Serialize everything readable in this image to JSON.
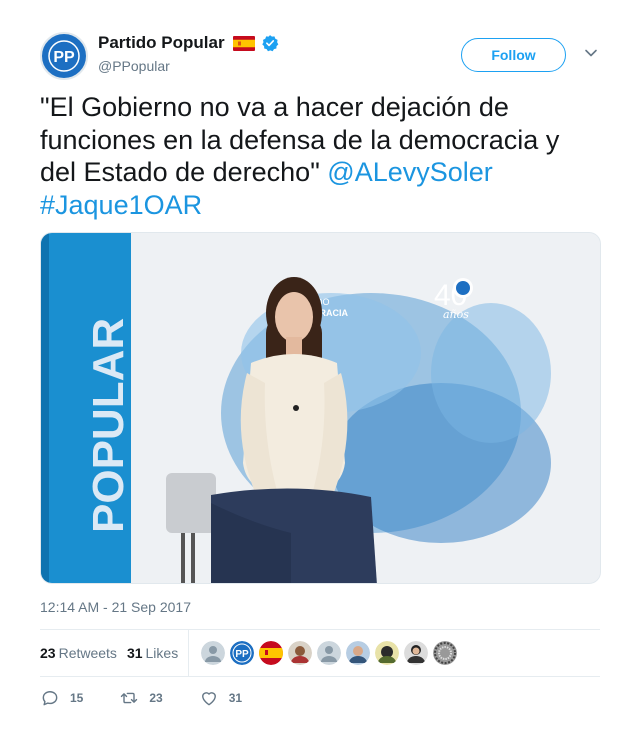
{
  "author": {
    "display_name": "Partido Popular",
    "handle": "@PPopular",
    "avatar_icon": "pp-logo-icon",
    "flag_icon": "spain-flag-icon",
    "verified_icon": "verified-badge-icon"
  },
  "follow_label": "Follow",
  "tweet": {
    "text_prefix": "\"El Gobierno no va a hacer dejación de funciones en la defensa de la democracia y del Estado de derecho\" ",
    "mention": "@ALevySoler",
    "hashtag": "#Jaque1OAR"
  },
  "photo": {
    "wall_text": "POPULAR",
    "sign_text_1": "DO",
    "sign_text_2": "CRACIA",
    "logo_number": "40",
    "logo_text": "años"
  },
  "timestamp": "12:14 AM - 21 Sep 2017",
  "stats": {
    "retweets_count": "23",
    "retweets_label": "Retweets",
    "likes_count": "31",
    "likes_label": "Likes"
  },
  "actions": {
    "reply_count": "15",
    "retweet_count": "23",
    "like_count": "31"
  },
  "colors": {
    "accent": "#1da1f2",
    "link": "#1b95e0",
    "pp_blue": "#1d6fc2"
  }
}
